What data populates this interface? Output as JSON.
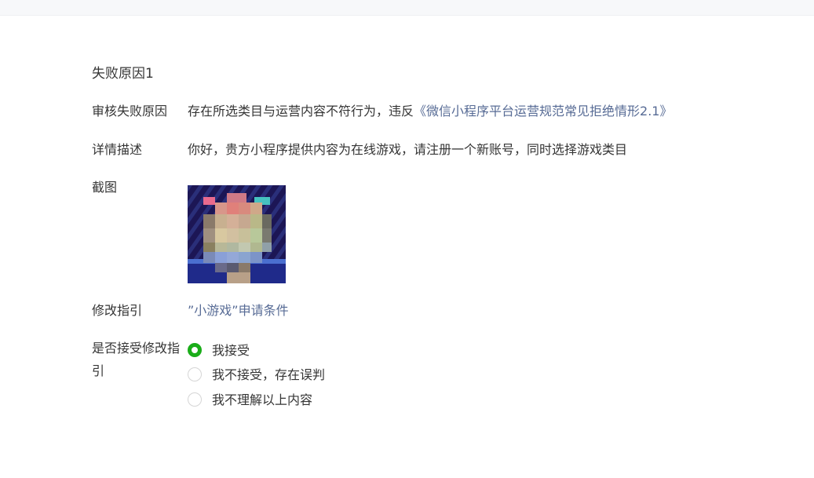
{
  "section_title": "失败原因1",
  "fields": {
    "reason_label": "审核失败原因",
    "reason_text": "存在所选类目与运营内容不符行为，违反",
    "reason_link": "《微信小程序平台运营规范常见拒绝情形2.1》",
    "detail_label": "详情描述",
    "detail_text": "你好，贵方小程序提供内容为在线游戏，请注册一个新账号，同时选择游戏类目",
    "screenshot_label": "截图",
    "guide_label": "修改指引",
    "guide_link": "”小游戏”申请条件",
    "accept_label": "是否接受修改指引"
  },
  "options": [
    {
      "label": "我接受",
      "selected": true
    },
    {
      "label": "我不接受，存在误判",
      "selected": false
    },
    {
      "label": "我不理解以上内容",
      "selected": false
    }
  ],
  "colors": {
    "link": "#576b95",
    "radio_checked": "#1aad19"
  }
}
